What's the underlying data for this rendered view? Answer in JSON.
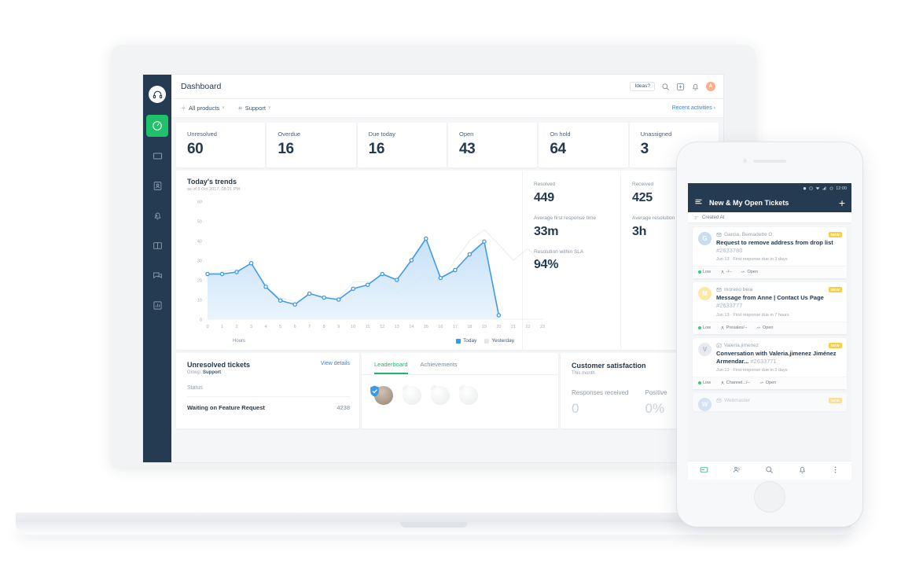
{
  "app": {
    "header": {
      "title": "Dashboard",
      "ideas_label": "Ideas?",
      "search_icon": "search-icon",
      "add_icon": "plus-square-icon",
      "bell_icon": "bell-icon",
      "avatar_initial": "A"
    },
    "filterbar": {
      "product_filter": "All products",
      "group_filter": "Support",
      "caret": "˅",
      "recent_activities": "Recent activities",
      "recent_arrow": "›"
    },
    "sidebar": {
      "logo_icon": "headset-logo-icon",
      "items": [
        {
          "icon": "dashboard-gauge-icon",
          "name": "dashboard",
          "active": true
        },
        {
          "icon": "ticket-icon",
          "name": "tickets",
          "active": false
        },
        {
          "icon": "contacts-icon",
          "name": "contacts",
          "active": false
        },
        {
          "icon": "alerts-bell-icon",
          "name": "alerts",
          "active": false
        },
        {
          "icon": "knowledge-book-icon",
          "name": "solutions",
          "active": false
        },
        {
          "icon": "forum-chat-icon",
          "name": "forums",
          "active": false
        },
        {
          "icon": "reports-bar-icon",
          "name": "reports",
          "active": false
        }
      ]
    },
    "kpis": [
      {
        "label": "Unresolved",
        "value": "60"
      },
      {
        "label": "Overdue",
        "value": "16"
      },
      {
        "label": "Due today",
        "value": "16"
      },
      {
        "label": "Open",
        "value": "43"
      },
      {
        "label": "On hold",
        "value": "64"
      },
      {
        "label": "Unassigned",
        "value": "3"
      }
    ],
    "trends": {
      "title": "Today's trends",
      "subtitle": "as of 5 Oct 2017, 08:21 PM",
      "stats_left": [
        {
          "label": "Resolved",
          "value": "449"
        },
        {
          "label": "Average first response time",
          "value": "33m"
        },
        {
          "label": "Resolution within SLA",
          "value": "94%"
        }
      ],
      "stats_right": [
        {
          "label": "Received",
          "value": "425"
        },
        {
          "label": "Average resolution time",
          "value": "3h"
        }
      ]
    },
    "unresolved_panel": {
      "title": "Unresolved tickets",
      "group_prefix": "Group:",
      "group_value": "Support",
      "view_details": "View details",
      "status_header": "Status",
      "rows": [
        {
          "name": "Waiting on Feature Request",
          "count": "4238"
        }
      ]
    },
    "leaderboard_panel": {
      "tabs": [
        {
          "label": "Leaderboard",
          "active": true
        },
        {
          "label": "Achievements",
          "active": false
        }
      ]
    },
    "csat_panel": {
      "title": "Customer satisfaction",
      "subtitle": "This month",
      "metrics": [
        {
          "label": "Responses received",
          "value": "0"
        },
        {
          "label": "Positive",
          "value": "0%"
        }
      ]
    }
  },
  "chart_data": {
    "type": "area",
    "title": "Today's trends",
    "subtitle": "as of 5 Oct 2017, 08:21 PM",
    "xlabel": "Hours",
    "ylabel": "",
    "xlim": [
      0,
      23
    ],
    "ylim": [
      0,
      60
    ],
    "yticks": [
      0,
      10,
      20,
      30,
      40,
      50,
      60
    ],
    "x": [
      0,
      1,
      2,
      3,
      4,
      5,
      6,
      7,
      8,
      9,
      10,
      11,
      12,
      13,
      14,
      15,
      16,
      17,
      18,
      19,
      20,
      21,
      22,
      23
    ],
    "grid": false,
    "legend_position": "bottom-right",
    "series": [
      {
        "name": "Today",
        "color": "#3f9ae5",
        "fill": "#cfe5f8",
        "markers": true,
        "values": [
          23,
          23,
          24,
          28.5,
          16.5,
          9.5,
          7.5,
          13,
          11,
          10,
          15.5,
          17.5,
          23,
          20,
          30,
          41,
          21,
          25,
          33,
          39.5,
          2,
          null,
          null,
          null
        ]
      },
      {
        "name": "Yesterday",
        "color": "#e9ecf0",
        "fill": "none",
        "markers": false,
        "values": [
          23,
          24,
          25.5,
          24,
          16,
          11,
          9,
          11,
          11.5,
          11,
          19,
          19,
          19,
          13.5,
          17.5,
          23,
          18,
          30,
          40,
          45.5,
          38,
          30,
          36,
          28
        ]
      }
    ]
  },
  "phone": {
    "status_bar": {
      "time": "12:00",
      "icons": [
        "alarm-icon",
        "shield-icon",
        "wifi-icon",
        "signal-icon",
        "battery-icon"
      ]
    },
    "header": {
      "menu_icon": "hamburger-menu-icon",
      "title": "New & My Open Tickets",
      "add_icon": "plus-icon"
    },
    "sort": {
      "icon": "sort-icon",
      "label": "Created At"
    },
    "tickets": [
      {
        "avatar_initial": "G",
        "avatar_color": "#c6ddf3",
        "requester": "Garcia, Bernadette G.",
        "channel_icon": "email-icon",
        "subject": "Request to remove address from drop list",
        "number": "#2633780",
        "meta": "Jun 13 · First response due in 3 days",
        "badge": "NEW",
        "tags": [
          "Low",
          "-/--",
          "Open"
        ]
      },
      {
        "avatar_initial": "M",
        "avatar_color": "#fbe9a6",
        "requester": "moreno beia",
        "channel_icon": "email-icon",
        "subject": "Message from Anne | Contact Us Page",
        "number": "#2633777",
        "meta": "Jun 13 · First response due in 7 hours",
        "badge": "NEW",
        "tags": [
          "Low",
          "Presales/--",
          "Open"
        ]
      },
      {
        "avatar_initial": "V",
        "avatar_color": "#e7eaee",
        "requester": "Valeria.jimenez",
        "channel_icon": "portal-icon",
        "subject": "Conversation with Valeria.jimenez Jiménez Armendar...",
        "number": "#2633771",
        "meta": "Jun 13 · First response due in 3 days",
        "badge": "NEW",
        "tags": [
          "Low",
          "Channel.../--",
          "Open"
        ]
      },
      {
        "avatar_initial": "W",
        "avatar_color": "#bcd4ef",
        "requester": "Webmaster",
        "channel_icon": "email-icon",
        "subject": "",
        "number": "",
        "meta": "",
        "badge": "NEW",
        "tags": []
      }
    ],
    "nav": [
      {
        "icon": "tickets-icon",
        "name": "tickets",
        "active": true
      },
      {
        "icon": "contacts-icon",
        "name": "contacts",
        "active": false
      },
      {
        "icon": "search-icon",
        "name": "search",
        "active": false
      },
      {
        "icon": "bell-icon",
        "name": "notifications",
        "active": false
      },
      {
        "icon": "more-vertical-icon",
        "name": "more",
        "active": false
      }
    ]
  }
}
